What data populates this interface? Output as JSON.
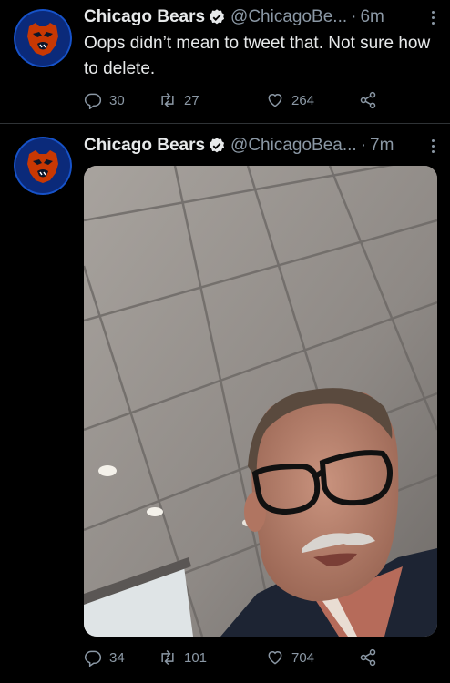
{
  "tweets": [
    {
      "author_name": "Chicago Bears",
      "handle": "@ChicagoBe...",
      "separator": "·",
      "time": "6m",
      "text": "Oops didn’t mean to tweet that. Not sure how to delete.",
      "replies": "30",
      "retweets": "27",
      "likes": "264"
    },
    {
      "author_name": "Chicago Bears",
      "handle": "@ChicagoBea...",
      "separator": "·",
      "time": "7m",
      "media": "selfie-photo-man-glasses-office-ceiling",
      "replies": "34",
      "retweets": "101",
      "likes": "704"
    }
  ],
  "icons": {
    "reply": "reply-icon",
    "retweet": "retweet-icon",
    "like": "heart-icon",
    "share": "share-icon",
    "verified": "verified-badge-icon",
    "more": "more-options-icon"
  },
  "colors": {
    "background": "#000000",
    "text_primary": "#e7e9ea",
    "text_secondary": "#8b98a5",
    "verified_badge": "#e7e9ea",
    "bears_navy": "#0b162a",
    "bears_orange": "#c83803"
  }
}
